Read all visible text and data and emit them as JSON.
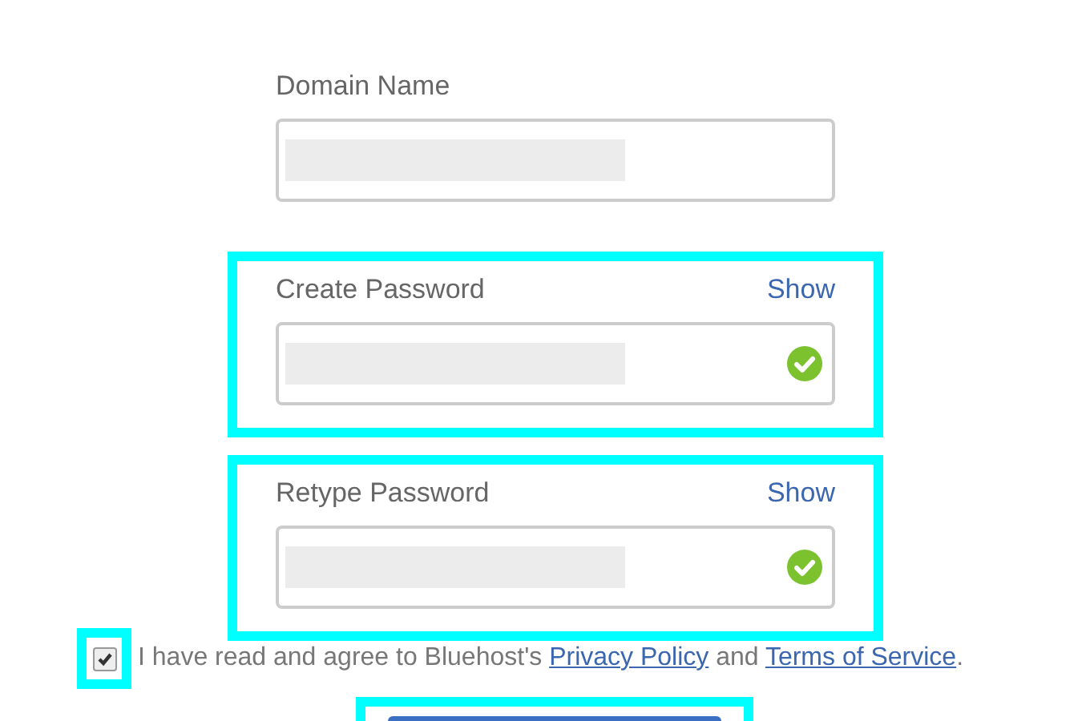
{
  "fields": [
    {
      "label": "Domain Name",
      "redacted": true,
      "valid": false,
      "highlighted": false
    },
    {
      "label": "Create Password",
      "show_link": "Show",
      "redacted": true,
      "valid": true,
      "highlighted": true
    },
    {
      "label": "Retype Password",
      "show_link": "Show",
      "redacted": true,
      "valid": true,
      "highlighted": true
    }
  ],
  "agreement": {
    "checked": true,
    "highlighted": true,
    "text_before": "I have read and agree to Bluehost's",
    "link_1": "Privacy Policy",
    "text_middle": "and",
    "link_2": "Terms of Service",
    "text_after": "."
  },
  "submit_button": {
    "highlighted": true
  }
}
